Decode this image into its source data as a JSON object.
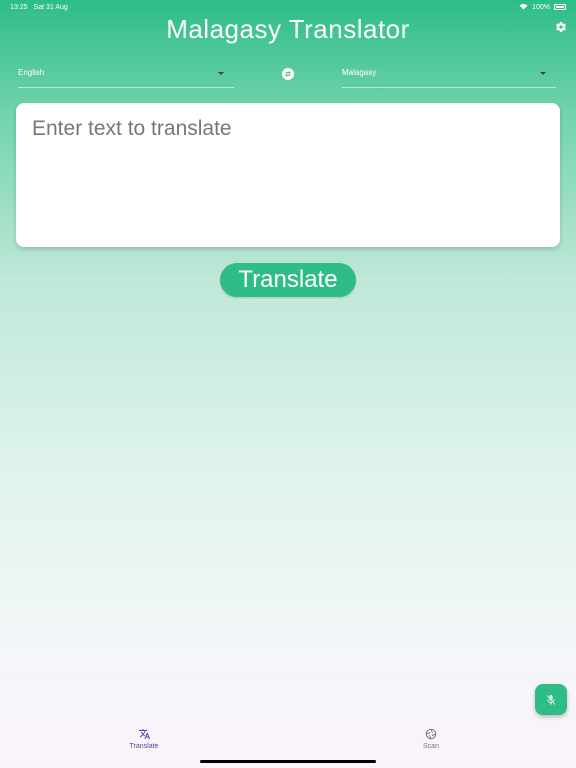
{
  "status_bar": {
    "time": "13:25",
    "date": "Sat 31 Aug",
    "battery": "100%"
  },
  "app": {
    "title": "Malagasy Translator"
  },
  "languages": {
    "source": "English",
    "target": "Malagasy"
  },
  "input": {
    "placeholder": "Enter text to translate",
    "value": ""
  },
  "actions": {
    "translate_label": "Translate"
  },
  "bottom_nav": {
    "items": [
      {
        "label": "Translate",
        "icon": "translate-icon",
        "selected": true
      },
      {
        "label": "Scan",
        "icon": "camera-lens-icon",
        "selected": false
      }
    ]
  },
  "colors": {
    "accent": "#2ebd86",
    "nav_selected": "#5b3fa0",
    "nav_unselected": "#777777"
  }
}
